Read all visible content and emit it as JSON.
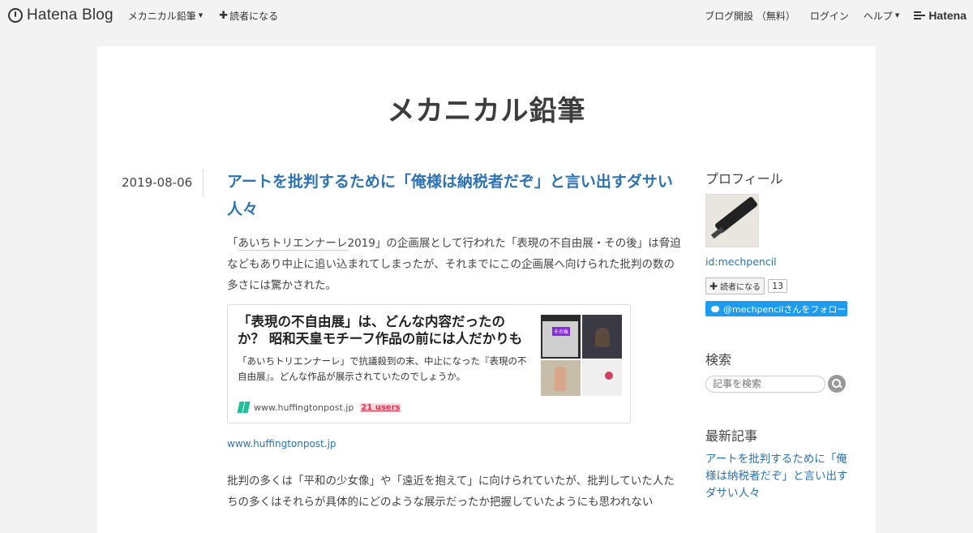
{
  "header": {
    "logo_text": "Hatena Blog",
    "blog_menu": "メカニカル鉛筆",
    "subscribe": "読者になる",
    "open_blog": "ブログ開設 （無料）",
    "login": "ログイン",
    "help": "ヘルプ",
    "brand": "Hatena"
  },
  "blog": {
    "title": "メカニカル鉛筆"
  },
  "entry": {
    "date": "2019-08-06",
    "title": "アートを批判するために「俺様は納税者だぞ」と言い出すダサい人々",
    "p1_pre": "「",
    "p1_kw": "あいちトリエンナーレ",
    "p1_post": "2019」の企画展として行われた「表現の不自由展・その後」は脅迫などもあり中止に追い込まれてしまったが、それまでにこの企画展へ向けられた批判の数の多さには驚かされた。",
    "card": {
      "title": "「表現の不自由展」は、どんな内容だったのか？ 昭和天皇モチーフ作品の前には人だかりも",
      "desc": "「あいちトリエンナーレ」で抗議殺到の末、中止になった『表現の不自由展』。どんな作品が展示されていたのでしょうか。",
      "domain": "www.huffingtonpost.jp",
      "users": "21 users",
      "thumb_tag": "その後"
    },
    "source_link": "www.huffingtonpost.jp",
    "p2": "批判の多くは「平和の少女像」や「遠近を抱えて」に向けられていたが、批判していた人たちの多くはそれらが具体的にどのような展示だったか把握していたようにも思われない"
  },
  "sidebar": {
    "profile_heading": "プロフィール",
    "profile_id": "id:mechpencil",
    "reader_button": "読者になる",
    "reader_count": "13",
    "twitter_follow": "@mechpencilさんをフォロー",
    "search_heading": "検索",
    "search_placeholder": "記事を検索",
    "recent_heading": "最新記事",
    "recent_item": "アートを批判するために「俺様は納税者だぞ」と言い出すダサい人々"
  },
  "colors": {
    "link": "#2c73b3",
    "twitter": "#1d9bf0",
    "users_badge": "#e0324b"
  }
}
